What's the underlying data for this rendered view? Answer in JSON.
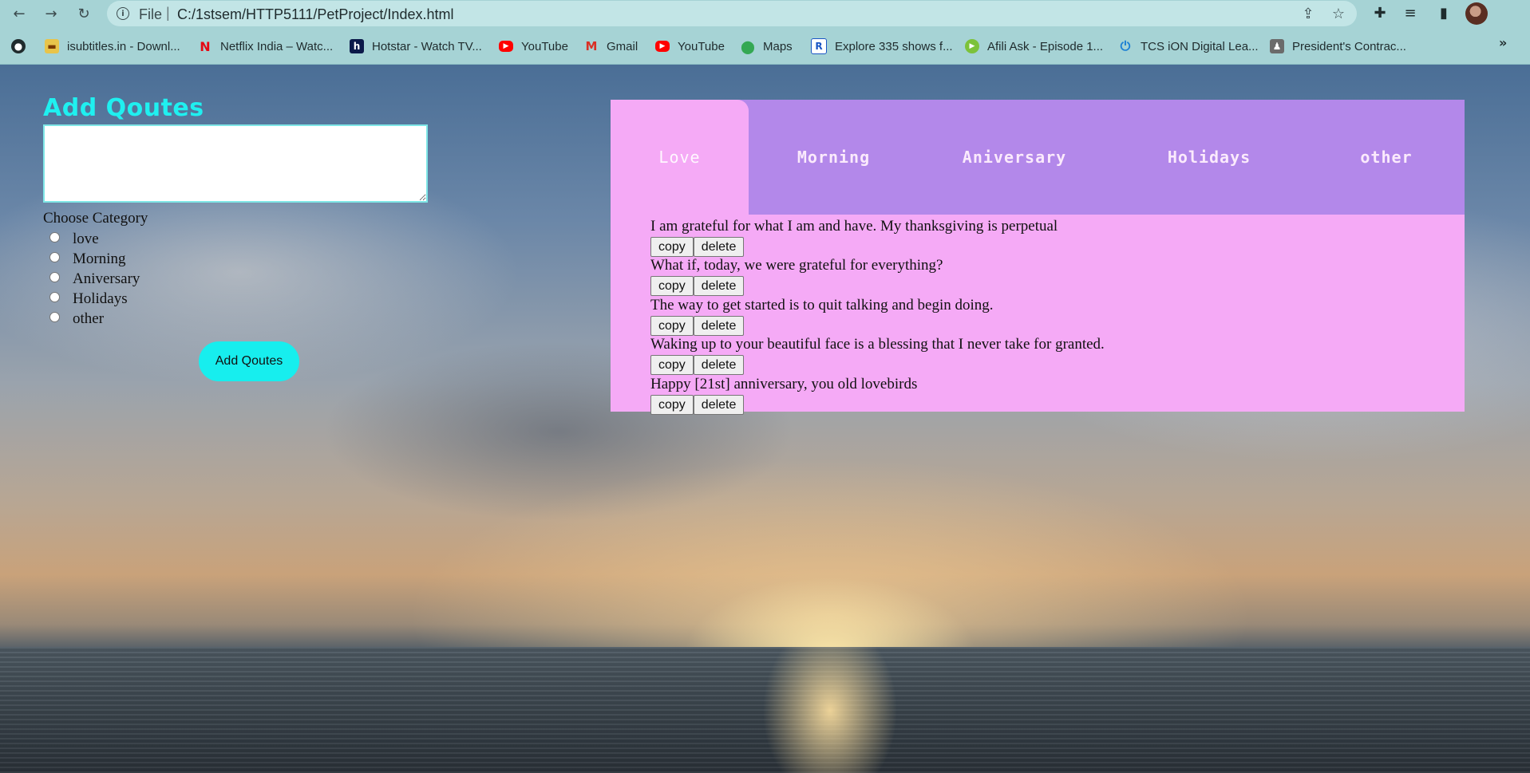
{
  "browser": {
    "url_scheme": "File",
    "url": "C:/1stsem/HTTP5111/PetProject/Index.html",
    "bookmarks": [
      {
        "label": "isubtitles.in - Downl...",
        "icon": "isubtitles-icon"
      },
      {
        "label": "Netflix India – Watc...",
        "icon": "netflix-icon"
      },
      {
        "label": "Hotstar - Watch TV...",
        "icon": "hotstar-icon"
      },
      {
        "label": "YouTube",
        "icon": "youtube-icon"
      },
      {
        "label": "Gmail",
        "icon": "gmail-icon"
      },
      {
        "label": "YouTube",
        "icon": "youtube-icon"
      },
      {
        "label": "Maps",
        "icon": "maps-icon"
      },
      {
        "label": "Explore 335 shows f...",
        "icon": "explore-icon"
      },
      {
        "label": "Afili Ask - Episode 1...",
        "icon": "play-icon"
      },
      {
        "label": "TCS iON Digital Lea...",
        "icon": "tcs-icon"
      },
      {
        "label": "President's Contrac...",
        "icon": "president-icon"
      }
    ]
  },
  "form": {
    "title": "Add Qoutes",
    "category_label": "Choose Category",
    "categories": [
      "love",
      "Morning",
      "Aniversary",
      "Holidays",
      "other"
    ],
    "submit_label": "Add Qoutes"
  },
  "panel": {
    "tabs": [
      "Love",
      "Morning",
      "Aniversary",
      "Holidays",
      "other"
    ],
    "active_tab": "Love",
    "quotes": [
      "I am grateful for what I am and have. My thanksgiving is perpetual",
      "What if, today, we were grateful for everything?",
      "The way to get started is to quit talking and begin doing.",
      "Waking up to your beautiful face is a blessing that I never take for granted.",
      "Happy [21st] anniversary, you old lovebirds"
    ],
    "copy_label": "copy",
    "delete_label": "delete"
  },
  "colors": {
    "accent_cyan": "#17eeee",
    "panel_pink": "#f5aaf6",
    "tabs_purple": "#b388ea",
    "chrome": "#a6d3d5"
  }
}
